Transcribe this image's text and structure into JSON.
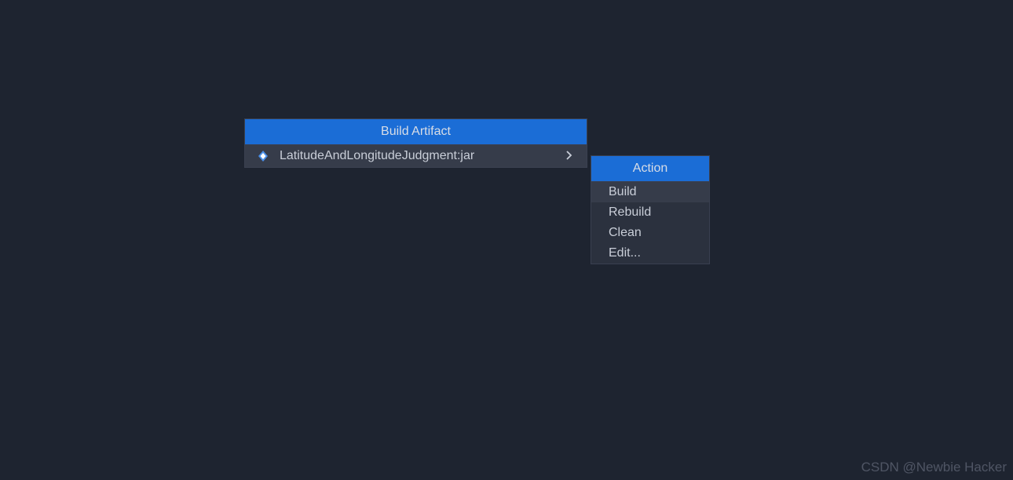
{
  "main_popup": {
    "header": "Build Artifact",
    "artifact": {
      "label": "LatitudeAndLongitudeJudgment:jar"
    }
  },
  "action_popup": {
    "header": "Action",
    "items": [
      {
        "label": "Build",
        "highlighted": true
      },
      {
        "label": "Rebuild",
        "highlighted": false
      },
      {
        "label": "Clean",
        "highlighted": false
      },
      {
        "label": "Edit...",
        "highlighted": false
      }
    ]
  },
  "watermark": "CSDN @Newbie Hacker"
}
